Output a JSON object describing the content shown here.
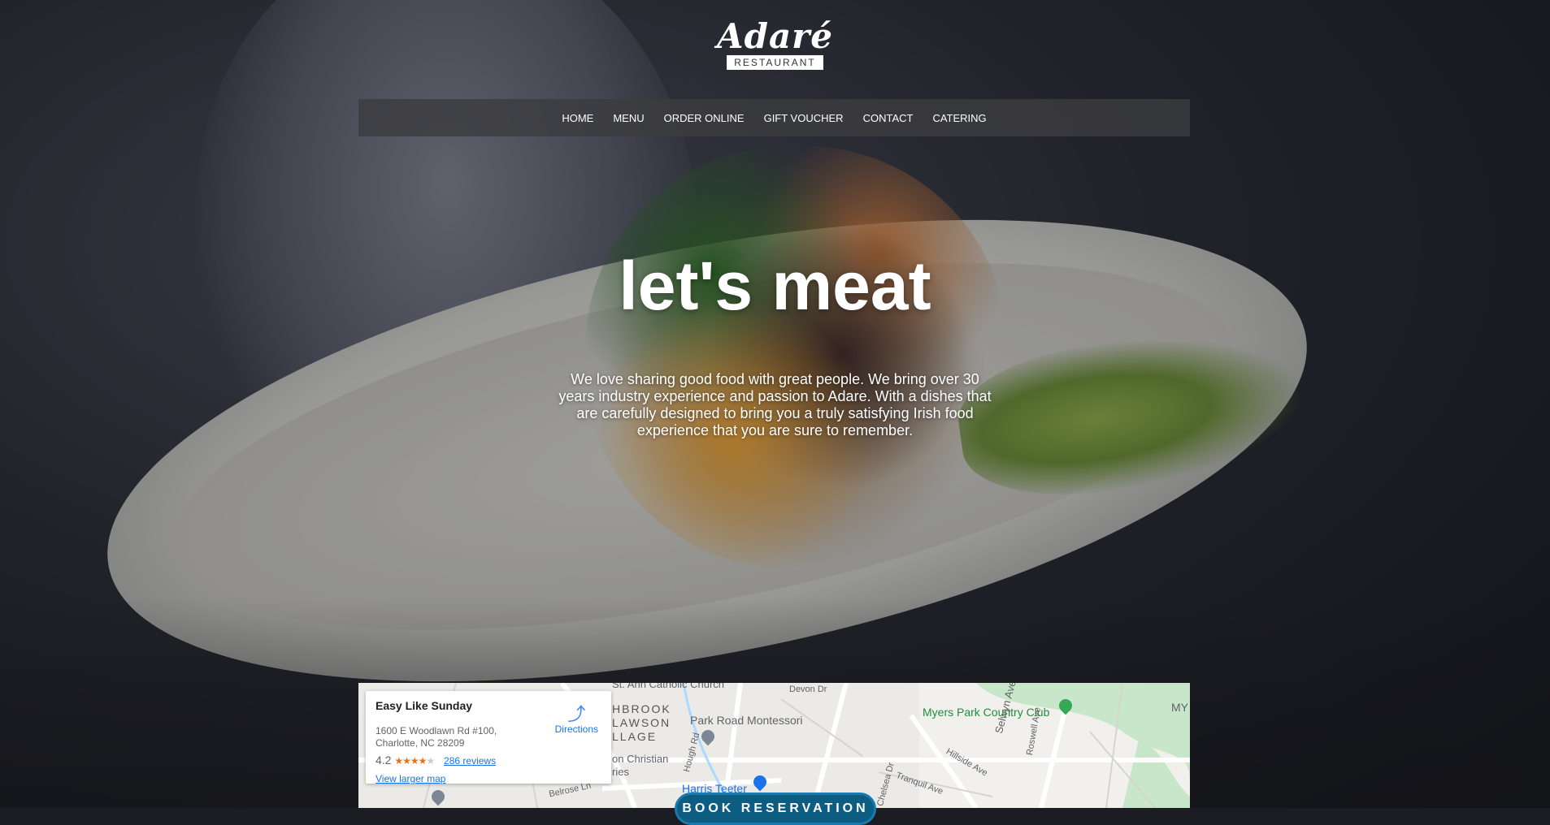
{
  "brand": {
    "name": "Adaré",
    "tagline": "RESTAURANT"
  },
  "nav": {
    "items": [
      {
        "label": "HOME"
      },
      {
        "label": "MENU"
      },
      {
        "label": "ORDER ONLINE"
      },
      {
        "label": "GIFT VOUCHER"
      },
      {
        "label": "CONTACT"
      },
      {
        "label": "CATERING"
      }
    ]
  },
  "hero": {
    "headline": "let's meat",
    "blurb": "We love sharing good food with great people. We bring over 30 years industry experience and passion to Adare. With a dishes that are carefully designed to bring you a truly satisfying Irish food experience that you are sure to remember."
  },
  "map": {
    "card": {
      "name": "Easy Like Sunday",
      "address_line1": "1600 E Woodlawn Rd #100,",
      "address_line2": "Charlotte, NC 28209",
      "rating": "4.2",
      "stars_full": "★★★★",
      "stars_empty": "★",
      "reviews": "286 reviews",
      "larger_map": "View larger map",
      "directions": "Directions"
    },
    "labels": {
      "church": "St. Ann Catholic Church",
      "neighborhood_1": "HBROOK",
      "neighborhood_2": "LAWSON",
      "neighborhood_3": "LLAGE",
      "montessori": "Park Road Montessori",
      "club": "Myers Park Country Club",
      "christian_1": "on Christian",
      "christian_2": "ries",
      "harris": "Harris Teeter",
      "selwyn": "Selwyn Ave",
      "hillside": "Hillside Ave",
      "tranquil": "Tranquil Ave",
      "roswell": "Roswell Ave",
      "devon": "Devon Dr",
      "belrose": "Belrose Ln",
      "hough": "Hough Rd",
      "chelsea": "Chelsea Dr",
      "my": "MY"
    },
    "colors": {
      "water": "#aadaff",
      "park": "#c8e6c9",
      "road": "#ffffff",
      "accent": "#1a73e8"
    }
  },
  "booking": {
    "label": "BOOK RESERVATION"
  },
  "colors": {
    "nav_bg": "#3c3c40",
    "text": "#ffffff",
    "book_bg": "#0d5c82"
  }
}
